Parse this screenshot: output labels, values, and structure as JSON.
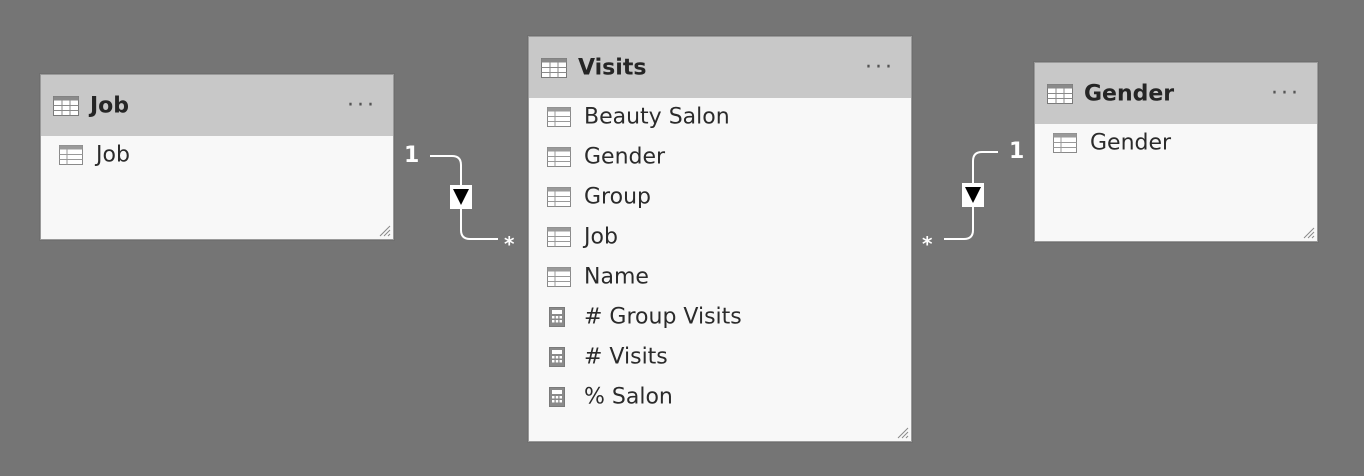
{
  "diagram": {
    "background_color": "#757575",
    "header_color": "#c8c8c8",
    "body_color": "#f8f8f8",
    "tables": {
      "job": {
        "title": "Job",
        "menu": "···",
        "icon": "table-icon",
        "fields": [
          {
            "label": "Job",
            "icon": "column-icon"
          }
        ]
      },
      "visits": {
        "title": "Visits",
        "menu": "···",
        "icon": "table-icon",
        "fields": [
          {
            "label": "Beauty Salon",
            "icon": "column-icon"
          },
          {
            "label": "Gender",
            "icon": "column-icon"
          },
          {
            "label": "Group",
            "icon": "column-icon"
          },
          {
            "label": "Job",
            "icon": "column-icon"
          },
          {
            "label": "Name",
            "icon": "column-icon"
          },
          {
            "label": "# Group Visits",
            "icon": "measure-icon"
          },
          {
            "label": "# Visits",
            "icon": "measure-icon"
          },
          {
            "label": "% Salon",
            "icon": "measure-icon"
          }
        ]
      },
      "gender": {
        "title": "Gender",
        "menu": "···",
        "icon": "table-icon",
        "fields": [
          {
            "label": "Gender",
            "icon": "column-icon"
          }
        ]
      }
    },
    "relationships": [
      {
        "from": "Job",
        "to": "Visits",
        "one_label": "1",
        "many_label": "*",
        "filter_direction": "single"
      },
      {
        "from": "Gender",
        "to": "Visits",
        "one_label": "1",
        "many_label": "*",
        "filter_direction": "single"
      }
    ]
  }
}
